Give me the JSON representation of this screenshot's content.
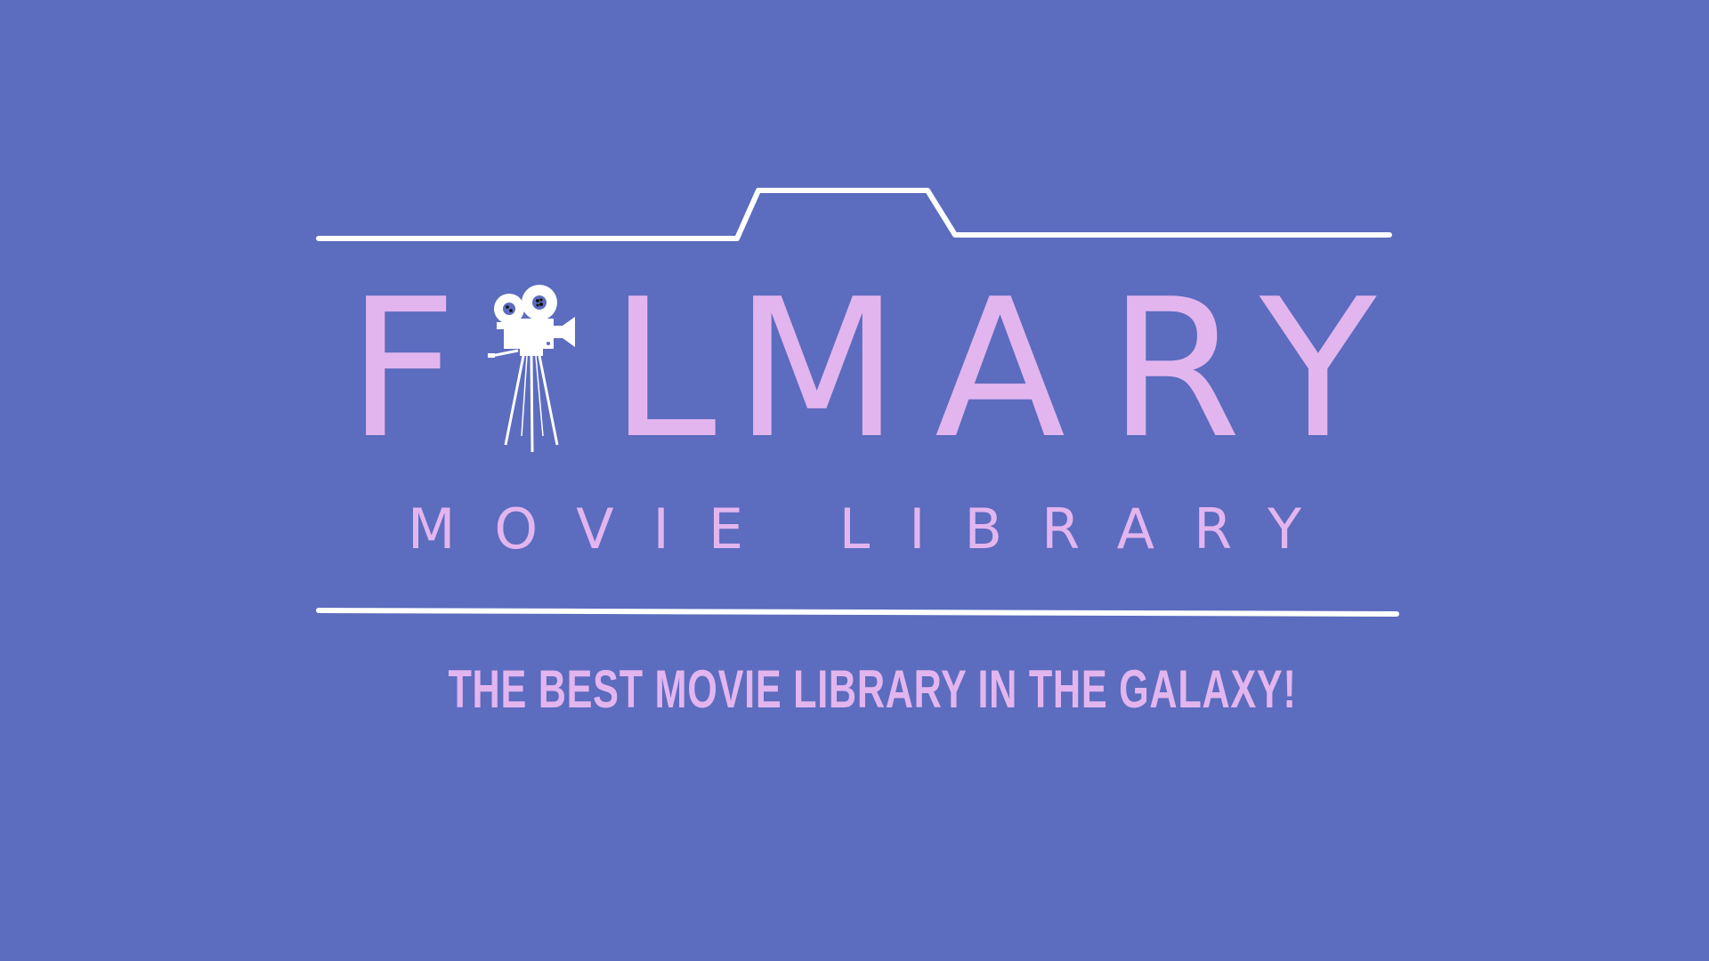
{
  "brand": {
    "letters": [
      "F",
      "L",
      "M",
      "A",
      "R",
      "Y"
    ],
    "icon": "movie-camera-on-tripod-icon",
    "subtitle": "MOVIE LIBRARY",
    "tagline": "THE BEST MOVIE LIBRARY IN THE GALAXY!"
  },
  "colors": {
    "background": "#5c6cbf",
    "text": "#e3b5ee",
    "lines": "#ffffff"
  }
}
